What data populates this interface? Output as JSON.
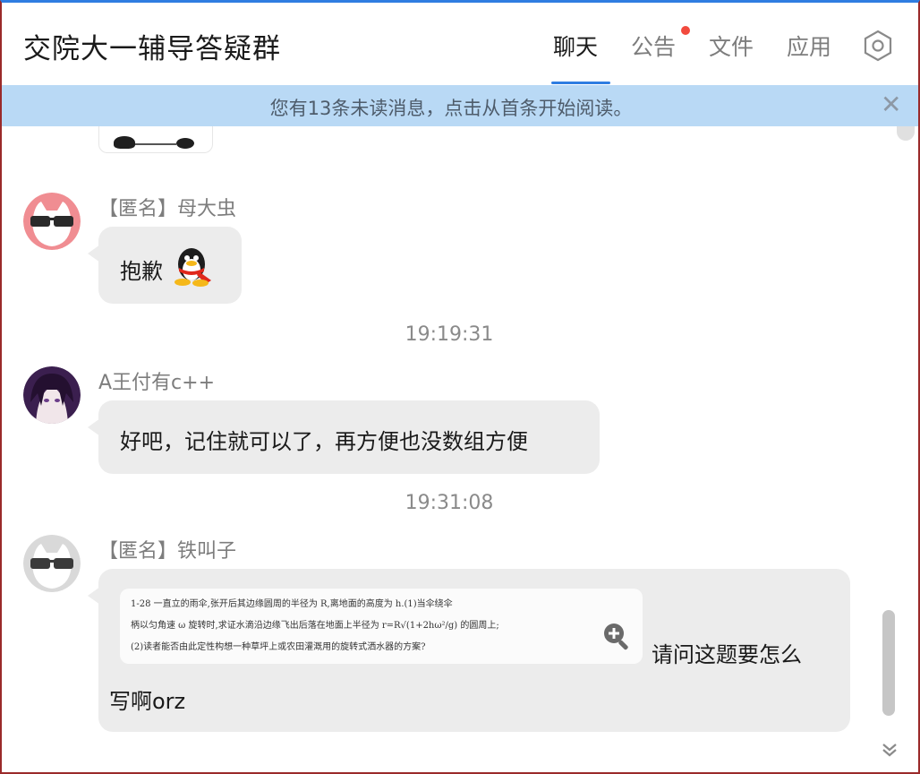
{
  "header": {
    "title": "交院大一辅导答疑群",
    "tabs": [
      {
        "label": "聊天",
        "active": true
      },
      {
        "label": "公告",
        "has_dot": true
      },
      {
        "label": "文件"
      },
      {
        "label": "应用"
      }
    ],
    "settings_icon": "hexagon-gear-icon"
  },
  "unread_bar": {
    "text": "您有13条未读消息，点击从首条开始阅读。",
    "close_icon": "close-icon"
  },
  "messages": [
    {
      "sender": "【匿名】母大虫",
      "text": "抱歉",
      "emoji": "qq-penguin-emoji",
      "avatar": "sunglasses-cat-avatar-pink"
    },
    {
      "timestamp": "19:19:31"
    },
    {
      "sender": "A王付有c++",
      "text": "好吧，记住就可以了，再方便也没数组方便",
      "avatar": "anime-girl-avatar"
    },
    {
      "timestamp": "19:31:08"
    },
    {
      "sender": "【匿名】铁叫子",
      "text_after_image": "请问这题要怎么",
      "text_line2": "写啊orz",
      "avatar": "sunglasses-cat-avatar-gray",
      "image": {
        "line1": "1-28  一直立的雨伞,张开后其边缘圆周的半径为 R,离地面的高度为 h.(1)当伞绕伞",
        "line2": "柄以匀角速 ω 旋转时,求证水滴沿边缘飞出后落在地面上半径为 r=R√(1+2hω²/g) 的圆周上;",
        "line3": "(2)读者能否由此定性构想一种草坪上或农田灌溉用的旋转式洒水器的方案?",
        "zoom_icon": "zoom-in-icon"
      }
    }
  ],
  "colors": {
    "accent": "#2f7de1",
    "unread_bg": "#b9d9f5",
    "bubble": "#ececec",
    "notice_dot": "#f24a3e"
  }
}
